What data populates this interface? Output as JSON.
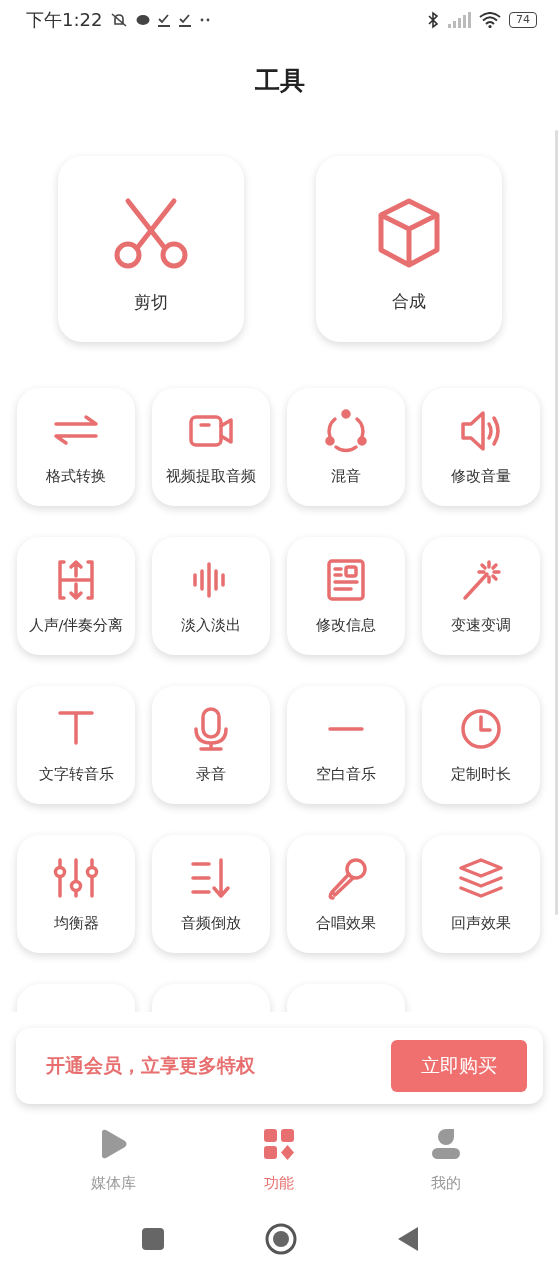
{
  "status_bar": {
    "time": "下午1:22",
    "battery": "74"
  },
  "title": "工具",
  "main_tools": [
    {
      "label": "剪切"
    },
    {
      "label": "合成"
    }
  ],
  "tools": [
    {
      "label": "格式转换"
    },
    {
      "label": "视频提取音频"
    },
    {
      "label": "混音"
    },
    {
      "label": "修改音量"
    },
    {
      "label": "人声/伴奏分离"
    },
    {
      "label": "淡入淡出"
    },
    {
      "label": "修改信息"
    },
    {
      "label": "变速变调"
    },
    {
      "label": "文字转音乐"
    },
    {
      "label": "录音"
    },
    {
      "label": "空白音乐"
    },
    {
      "label": "定制时长"
    },
    {
      "label": "均衡器"
    },
    {
      "label": "音频倒放"
    },
    {
      "label": "合唱效果"
    },
    {
      "label": "回声效果"
    }
  ],
  "banner": {
    "text": "开通会员，立享更多特权",
    "button": "立即购买"
  },
  "tabs": [
    {
      "label": "媒体库",
      "selected": false
    },
    {
      "label": "功能",
      "selected": true
    },
    {
      "label": "我的",
      "selected": false
    }
  ]
}
